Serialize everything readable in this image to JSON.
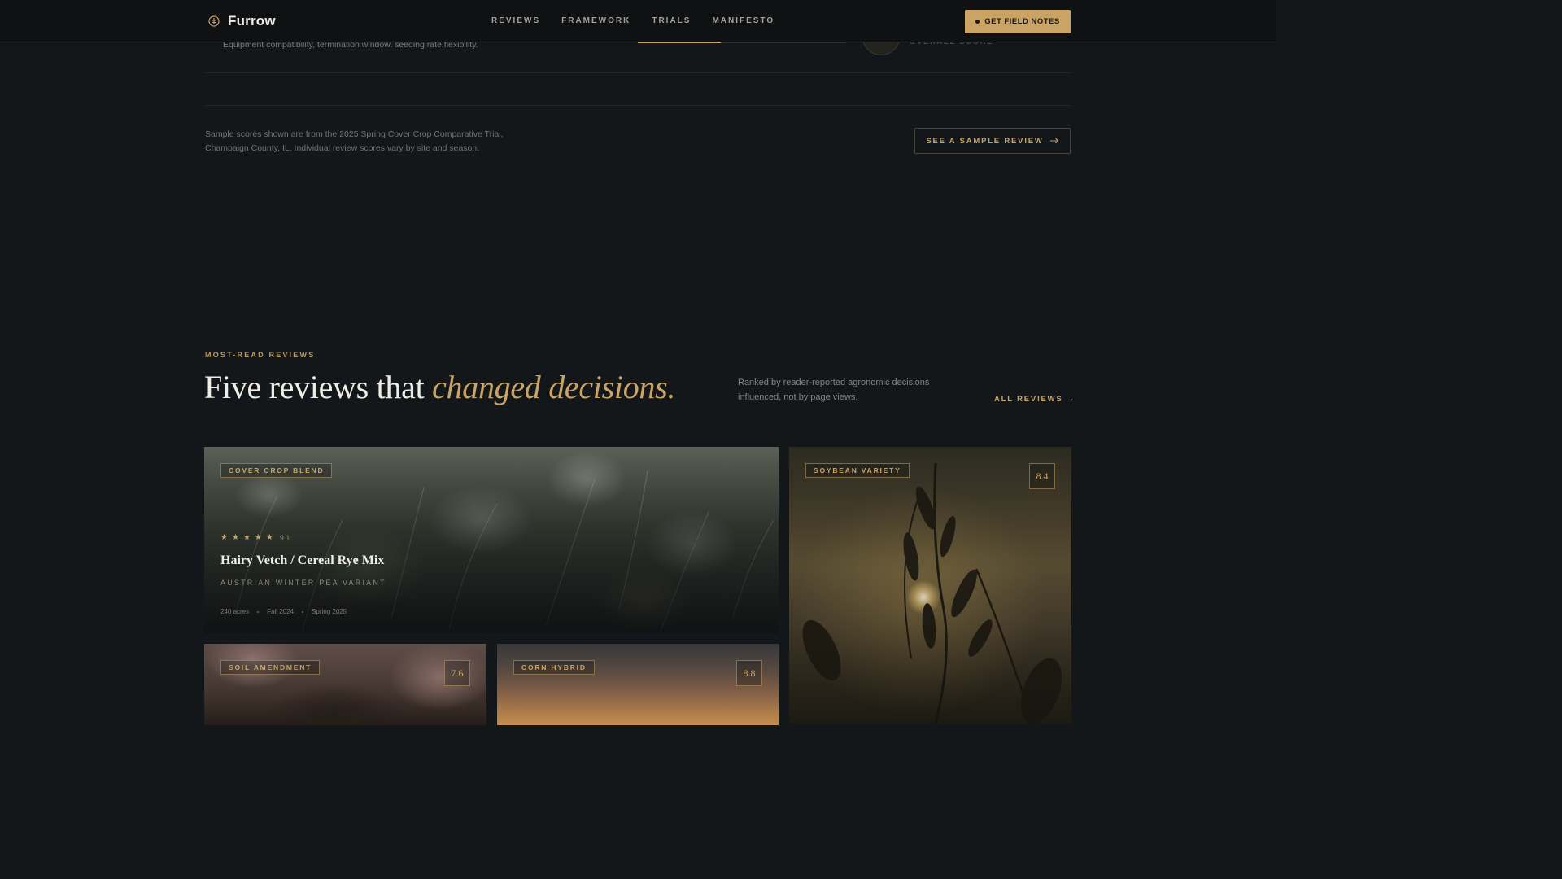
{
  "brand": {
    "name": "Furrow"
  },
  "nav": {
    "items": [
      "REVIEWS",
      "FRAMEWORK",
      "TRIALS",
      "MANIFESTO"
    ],
    "cta_label": "GET FIELD NOTES"
  },
  "top_section": {
    "criteria_line": "Equipment compatibility, termination window, seeding rate flexibility.",
    "score_label": "OVERALL SCORE",
    "progress": 0.4
  },
  "footnote": {
    "text": "Sample scores shown are from the 2025 Spring Cover Crop Comparative Trial, Champaign County, IL. Individual review scores vary by site and season.",
    "button_label": "SEE A SAMPLE REVIEW"
  },
  "reviews_section": {
    "eyebrow": "MOST-READ REVIEWS",
    "headline_plain": "Five reviews that ",
    "headline_accent": "changed decisions.",
    "description": "Ranked by reader-reported agronomic decisions influenced, not by page views.",
    "all_reviews_label": "ALL REVIEWS →"
  },
  "cards": [
    {
      "tag": "COVER CROP BLEND",
      "stars": 5,
      "rating": "9.1",
      "title": "Hairy Vetch / Cereal Rye Mix",
      "subtitle": "AUSTRIAN WINTER PEA VARIANT",
      "meta": [
        "240 acres",
        "Fall 2024",
        "Spring 2025"
      ]
    },
    {
      "tag": "SOYBEAN VARIETY",
      "score": "8.4"
    },
    {
      "tag": "SOIL AMENDMENT",
      "score": "7.6"
    },
    {
      "tag": "CORN HYBRID",
      "score": "8.8"
    }
  ],
  "colors": {
    "accent": "#c9a464",
    "background": "#14171a",
    "header": "#0f1113"
  },
  "icons": [
    "seedling-logo-icon",
    "dot-icon",
    "arrow-right-icon",
    "star-icon"
  ]
}
